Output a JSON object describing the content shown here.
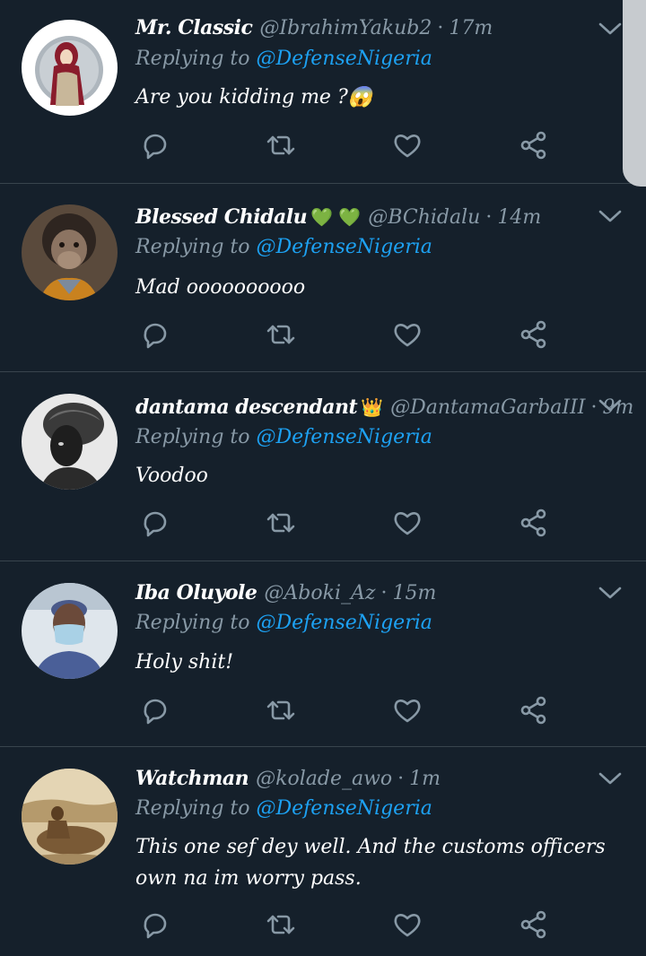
{
  "tweets": [
    {
      "name": "Mr. Classic",
      "name_emoji": "",
      "handle": "@IbrahimYakub2",
      "time": "17m",
      "replying_prefix": "Replying to",
      "replying_to": "@DefenseNigeria",
      "text": "Are you kidding me ?😱",
      "avatar": "avatar-hijab-illustration"
    },
    {
      "name": "Blessed Chidalu",
      "name_emoji": "💚 💚",
      "handle": "@BChidalu",
      "time": "14m",
      "replying_prefix": "Replying to",
      "replying_to": "@DefenseNigeria",
      "text": "Mad oooooooooo",
      "avatar": "avatar-chimpanzee"
    },
    {
      "name": "dantama descendant",
      "name_emoji": "👑",
      "handle": "@DantamaGarbaIII",
      "time": "9m",
      "replying_prefix": "Replying to",
      "replying_to": "@DefenseNigeria",
      "text": "Voodoo",
      "avatar": "avatar-woman-headwrap-bw"
    },
    {
      "name": "Iba Oluyole",
      "name_emoji": "",
      "handle": "@Aboki_Az",
      "time": "15m",
      "replying_prefix": "Replying to",
      "replying_to": "@DefenseNigeria",
      "text": "Holy shit!",
      "avatar": "avatar-surgeon-mask"
    },
    {
      "name": "Watchman",
      "name_emoji": "",
      "handle": "@kolade_awo",
      "time": "1m",
      "replying_prefix": "Replying to",
      "replying_to": "@DefenseNigeria",
      "text": "This one sef dey well. And the customs officers own na im worry pass.",
      "avatar": "avatar-sepia-sitting-man"
    }
  ],
  "icons": {
    "reply": "reply-icon",
    "retweet": "retweet-icon",
    "like": "heart-icon",
    "share": "share-icon",
    "menu": "chevron-down-icon"
  },
  "colors": {
    "background": "#15202b",
    "divider": "#38444d",
    "secondary_text": "#8899a6",
    "accent": "#1da1f2",
    "icon": "#8899a6"
  }
}
